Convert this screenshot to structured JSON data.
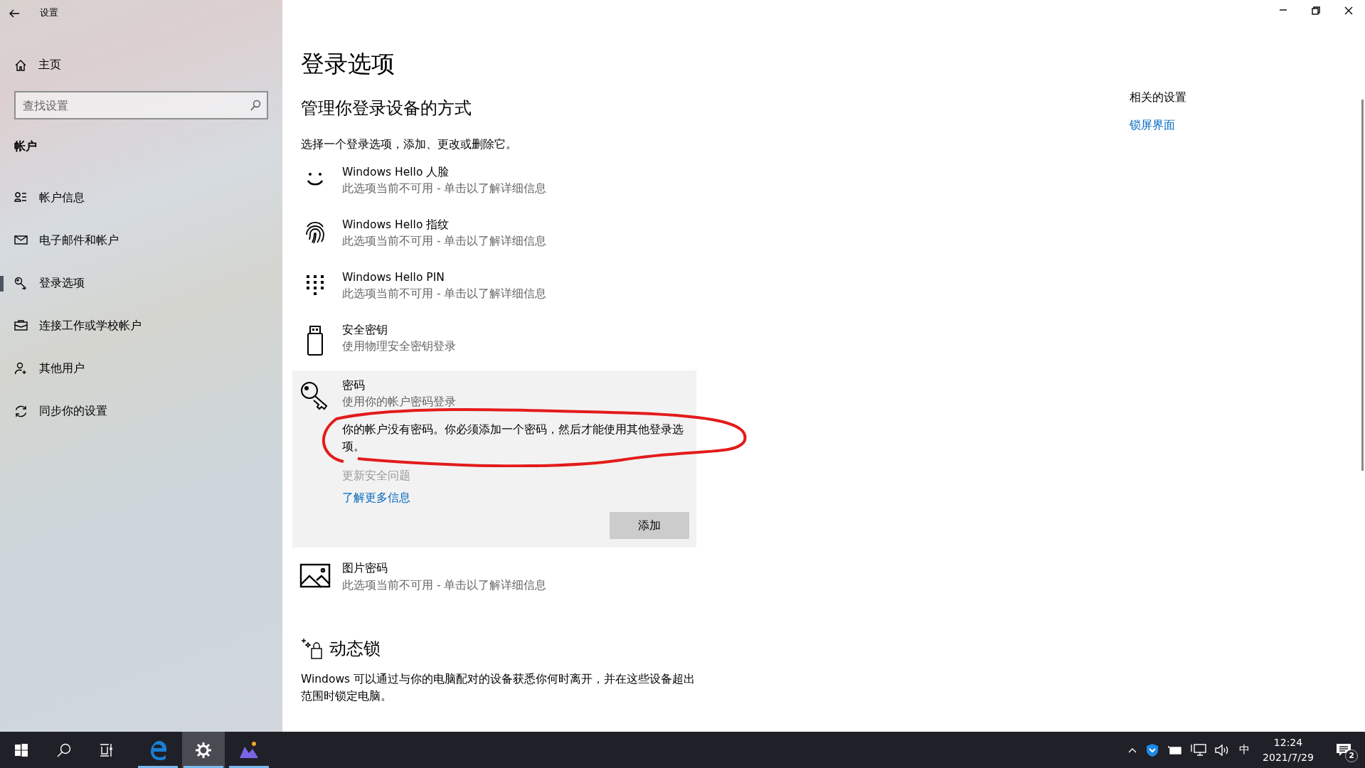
{
  "window": {
    "title": "设置"
  },
  "sidebar": {
    "home": "主页",
    "search": {
      "placeholder": "查找设置"
    },
    "section": "帐户",
    "items": [
      {
        "kind": "info",
        "label": "帐户信息",
        "selected": false
      },
      {
        "kind": "mail",
        "label": "电子邮件和帐户",
        "selected": false
      },
      {
        "kind": "key",
        "label": "登录选项",
        "selected": true
      },
      {
        "kind": "briefcase",
        "label": "连接工作或学校帐户",
        "selected": false
      },
      {
        "kind": "user-add",
        "label": "其他用户",
        "selected": false
      },
      {
        "kind": "sync",
        "label": "同步你的设置",
        "selected": false
      }
    ]
  },
  "main": {
    "title": "登录选项",
    "subtitle": "管理你登录设备的方式",
    "intro": "选择一个登录选项，添加、更改或删除它。",
    "options": [
      {
        "kind": "face",
        "title": "Windows Hello 人脸",
        "description": "此选项当前不可用 - 单击以了解详细信息",
        "expanded": false
      },
      {
        "kind": "fingerprint",
        "title": "Windows Hello 指纹",
        "description": "此选项当前不可用 - 单击以了解详细信息",
        "expanded": false
      },
      {
        "kind": "pin",
        "title": "Windows Hello PIN",
        "description": "此选项当前不可用 - 单击以了解详细信息",
        "expanded": false
      },
      {
        "kind": "usb",
        "title": "安全密钥",
        "description": "使用物理安全密钥登录",
        "expanded": false
      },
      {
        "kind": "key",
        "title": "密码",
        "description": "使用你的帐户密码登录",
        "expanded": true,
        "notice": {
          "text": "你的帐户没有密码。你必须添加一个密码，然后才能使用其他登录选项。",
          "circled": true
        },
        "links": [
          {
            "label": "更新安全问题",
            "disabled": true
          },
          {
            "label": "了解更多信息",
            "disabled": false
          }
        ],
        "button": "添加"
      },
      {
        "kind": "picture",
        "title": "图片密码",
        "description": "此选项当前不可用 - 单击以了解详细信息",
        "expanded": false
      }
    ],
    "dynamic_lock": {
      "title": "动态锁",
      "text": "Windows 可以通过与你的电脑配对的设备获悉你何时离开，并在这些设备超出范围时锁定电脑。"
    }
  },
  "related": {
    "title": "相关的设置",
    "links": [
      "锁屏界面"
    ]
  },
  "taskbar": {
    "apps": [
      {
        "kind": "edge",
        "active": false,
        "running": true
      },
      {
        "kind": "settings",
        "active": true,
        "running": true
      },
      {
        "kind": "photos",
        "active": false,
        "running": true
      }
    ],
    "ime": "中",
    "clock": {
      "time": "12:24",
      "date": "2021/7/29"
    },
    "notifications": "2"
  }
}
